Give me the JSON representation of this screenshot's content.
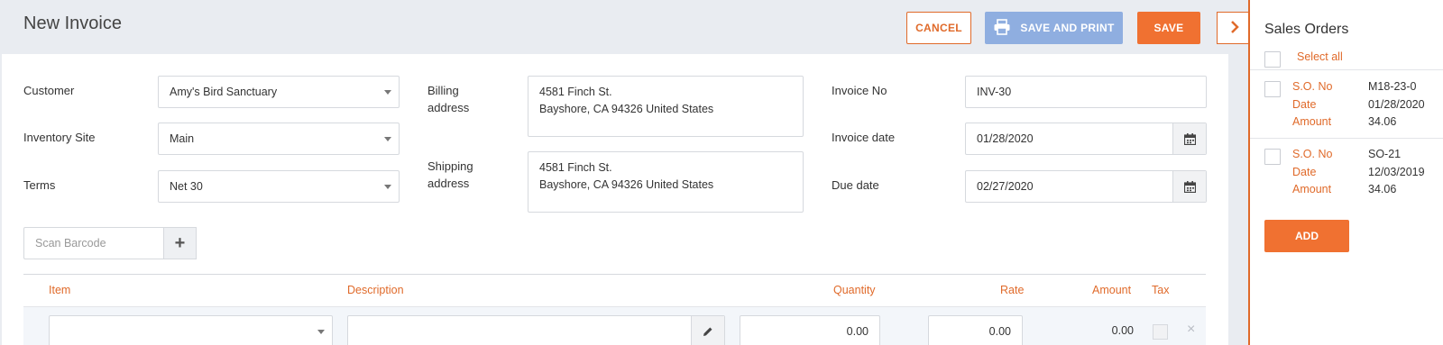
{
  "page": {
    "title": "New Invoice"
  },
  "toolbar": {
    "cancel_label": "CANCEL",
    "save_print_label": "SAVE AND PRINT",
    "save_label": "SAVE"
  },
  "form": {
    "customer": {
      "label": "Customer",
      "value": "Amy's Bird Sanctuary"
    },
    "inventory_site": {
      "label": "Inventory Site",
      "value": "Main"
    },
    "terms": {
      "label": "Terms",
      "value": "Net 30"
    },
    "billing": {
      "label_line1": "Billing",
      "label_line2": "address",
      "line1": "4581 Finch St.",
      "line2": "Bayshore, CA 94326 United States"
    },
    "shipping": {
      "label_line1": "Shipping",
      "label_line2": "address",
      "line1": "4581 Finch St.",
      "line2": "Bayshore, CA 94326 United States"
    },
    "invoice_no": {
      "label": "Invoice No",
      "value": "INV-30"
    },
    "invoice_date": {
      "label": "Invoice date",
      "value": "01/28/2020"
    },
    "due_date": {
      "label": "Due date",
      "value": "02/27/2020"
    }
  },
  "barcode": {
    "placeholder": "Scan Barcode",
    "add_symbol": "+"
  },
  "table": {
    "columns": {
      "item": "Item",
      "description": "Description",
      "quantity": "Quantity",
      "rate": "Rate",
      "amount": "Amount",
      "tax": "Tax"
    },
    "row": {
      "item": "",
      "description": "",
      "quantity": "0.00",
      "rate": "0.00",
      "amount": "0.00",
      "remove_symbol": "×"
    }
  },
  "sales_orders": {
    "title": "Sales Orders",
    "select_all_label": "Select all",
    "key_labels": {
      "so_no": "S.O. No",
      "date": "Date",
      "amount": "Amount"
    },
    "orders": [
      {
        "so_no": "M18-23-0",
        "date": "01/28/2020",
        "amount": "34.06"
      },
      {
        "so_no": "SO-21",
        "date": "12/03/2019",
        "amount": "34.06"
      }
    ],
    "add_label": "ADD"
  },
  "colors": {
    "accent": "#f07131",
    "accent_border": "#e06a2a",
    "save_print_bg": "#8faee0",
    "page_bg": "#e9ecf1"
  }
}
